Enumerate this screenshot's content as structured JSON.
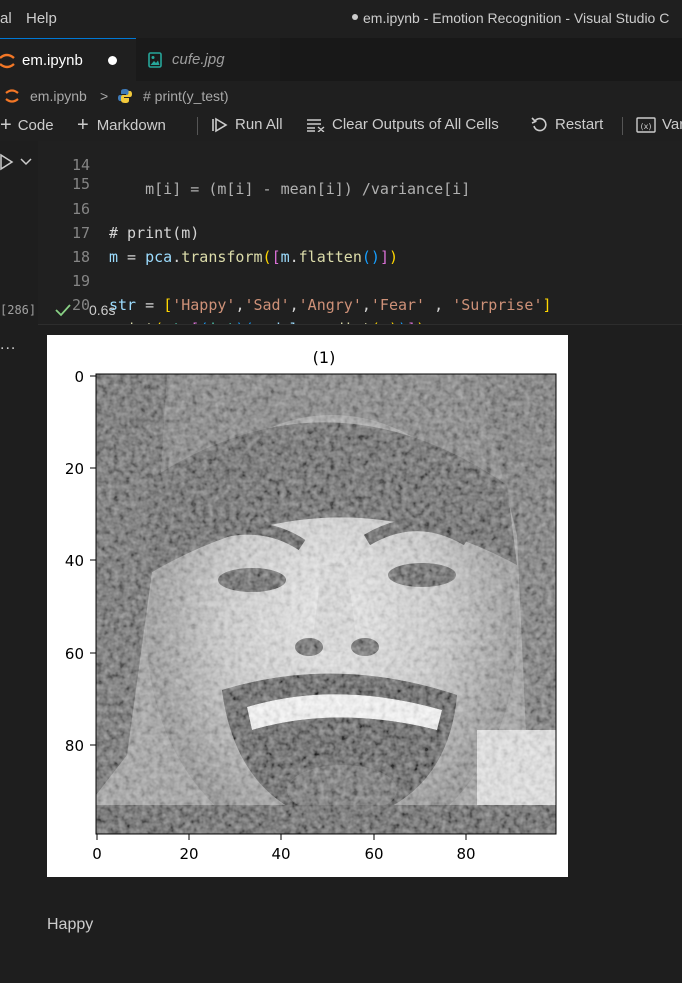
{
  "window": {
    "menu": [
      "al",
      "Help"
    ],
    "title": "em.ipynb - Emotion Recognition - Visual Studio C"
  },
  "tabs": [
    {
      "label": "em.ipynb",
      "icon": "jupyter-notebook-icon",
      "active": true,
      "dirty": true
    },
    {
      "label": "cufe.jpg",
      "icon": "image-file-icon",
      "active": false
    }
  ],
  "breadcrumb": {
    "file": "em.ipynb",
    "separator": ">",
    "cell": "# print(y_test)"
  },
  "toolbar": {
    "code": "Code",
    "markdown": "Markdown",
    "run_all": "Run All",
    "clear_outputs": "Clear Outputs of All Cells",
    "restart": "Restart",
    "variables": "Var"
  },
  "cell": {
    "exec_count": "[286]",
    "status": "0.6s",
    "lines": [
      {
        "n": "14",
        "text": "    m[i] = (m[i] - mean[i]) /variance[i]"
      },
      {
        "n": "15",
        "text": ""
      },
      {
        "n": "16",
        "text": "# print(m)"
      },
      {
        "n": "17",
        "text": "m = pca.transform([m.flatten()])"
      },
      {
        "n": "18",
        "text": ""
      },
      {
        "n": "19",
        "text": "str = ['Happy','Sad','Angry','Fear' , 'Surprise']"
      },
      {
        "n": "20",
        "text": "print(str[(int)(model.predict(m))])"
      }
    ]
  },
  "output": {
    "more": "...",
    "figure": {
      "title": "(1)",
      "image": "grayscale-face-photo",
      "x_ticks": [
        "0",
        "20",
        "40",
        "60",
        "80"
      ],
      "y_ticks": [
        "0",
        "20",
        "40",
        "60",
        "80"
      ],
      "x_range": [
        0,
        99
      ],
      "y_range": [
        0,
        99
      ]
    },
    "text": "Happy"
  },
  "colors": {
    "editor_bg": "#1e1e1e",
    "accent": "#0078d4",
    "check_green": "#89d185"
  }
}
